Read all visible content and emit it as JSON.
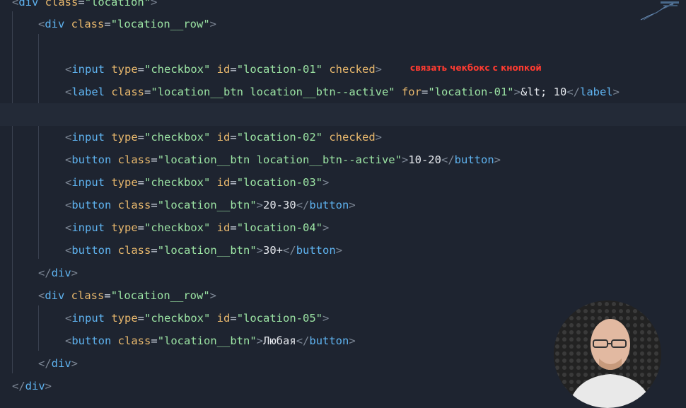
{
  "editor": {
    "lines": [
      [
        [
          "punct",
          "<"
        ],
        [
          "tag",
          "div "
        ],
        [
          "attr",
          "class"
        ],
        [
          "eq",
          "="
        ],
        [
          "str",
          "\"location\""
        ],
        [
          "punct",
          ">"
        ]
      ],
      [
        [
          "punct",
          "<"
        ],
        [
          "tag",
          "div "
        ],
        [
          "attr",
          "class"
        ],
        [
          "eq",
          "="
        ],
        [
          "str",
          "\"location__row\""
        ],
        [
          "punct",
          ">"
        ]
      ],
      [],
      [
        [
          "punct",
          "<"
        ],
        [
          "tag",
          "input "
        ],
        [
          "attr",
          "type"
        ],
        [
          "eq",
          "="
        ],
        [
          "str",
          "\"checkbox\" "
        ],
        [
          "attr",
          "id"
        ],
        [
          "eq",
          "="
        ],
        [
          "str",
          "\"location-01\" "
        ],
        [
          "attr",
          "checked"
        ],
        [
          "punct",
          ">"
        ]
      ],
      [
        [
          "punct",
          "<"
        ],
        [
          "tag",
          "label "
        ],
        [
          "attr",
          "class"
        ],
        [
          "eq",
          "="
        ],
        [
          "str",
          "\"location__btn location__btn--active\" "
        ],
        [
          "attr",
          "for"
        ],
        [
          "eq",
          "="
        ],
        [
          "str",
          "\"location-01\""
        ],
        [
          "punct",
          ">"
        ],
        [
          "text",
          "&lt; 10"
        ],
        [
          "punct",
          "</"
        ],
        [
          "tag",
          "label"
        ],
        [
          "punct",
          ">"
        ]
      ],
      [],
      [
        [
          "punct",
          "<"
        ],
        [
          "tag",
          "input "
        ],
        [
          "attr",
          "type"
        ],
        [
          "eq",
          "="
        ],
        [
          "str",
          "\"checkbox\" "
        ],
        [
          "attr",
          "id"
        ],
        [
          "eq",
          "="
        ],
        [
          "str",
          "\"location-02\" "
        ],
        [
          "attr",
          "checked"
        ],
        [
          "punct",
          ">"
        ]
      ],
      [
        [
          "punct",
          "<"
        ],
        [
          "tag",
          "button "
        ],
        [
          "attr",
          "class"
        ],
        [
          "eq",
          "="
        ],
        [
          "str",
          "\"location__btn location__btn--active\""
        ],
        [
          "punct",
          ">"
        ],
        [
          "text",
          "10-20"
        ],
        [
          "punct",
          "</"
        ],
        [
          "tag",
          "button"
        ],
        [
          "punct",
          ">"
        ]
      ],
      [
        [
          "punct",
          "<"
        ],
        [
          "tag",
          "input "
        ],
        [
          "attr",
          "type"
        ],
        [
          "eq",
          "="
        ],
        [
          "str",
          "\"checkbox\" "
        ],
        [
          "attr",
          "id"
        ],
        [
          "eq",
          "="
        ],
        [
          "str",
          "\"location-03\""
        ],
        [
          "punct",
          ">"
        ]
      ],
      [
        [
          "punct",
          "<"
        ],
        [
          "tag",
          "button "
        ],
        [
          "attr",
          "class"
        ],
        [
          "eq",
          "="
        ],
        [
          "str",
          "\"location__btn\""
        ],
        [
          "punct",
          ">"
        ],
        [
          "text",
          "20-30"
        ],
        [
          "punct",
          "</"
        ],
        [
          "tag",
          "button"
        ],
        [
          "punct",
          ">"
        ]
      ],
      [
        [
          "punct",
          "<"
        ],
        [
          "tag",
          "input "
        ],
        [
          "attr",
          "type"
        ],
        [
          "eq",
          "="
        ],
        [
          "str",
          "\"checkbox\" "
        ],
        [
          "attr",
          "id"
        ],
        [
          "eq",
          "="
        ],
        [
          "str",
          "\"location-04\""
        ],
        [
          "punct",
          ">"
        ]
      ],
      [
        [
          "punct",
          "<"
        ],
        [
          "tag",
          "button "
        ],
        [
          "attr",
          "class"
        ],
        [
          "eq",
          "="
        ],
        [
          "str",
          "\"location__btn\""
        ],
        [
          "punct",
          ">"
        ],
        [
          "text",
          "30+"
        ],
        [
          "punct",
          "</"
        ],
        [
          "tag",
          "button"
        ],
        [
          "punct",
          ">"
        ]
      ],
      [
        [
          "punct",
          "</"
        ],
        [
          "tag",
          "div"
        ],
        [
          "punct",
          ">"
        ]
      ],
      [
        [
          "punct",
          "<"
        ],
        [
          "tag",
          "div "
        ],
        [
          "attr",
          "class"
        ],
        [
          "eq",
          "="
        ],
        [
          "str",
          "\"location__row\""
        ],
        [
          "punct",
          ">"
        ]
      ],
      [
        [
          "punct",
          "<"
        ],
        [
          "tag",
          "input "
        ],
        [
          "attr",
          "type"
        ],
        [
          "eq",
          "="
        ],
        [
          "str",
          "\"checkbox\" "
        ],
        [
          "attr",
          "id"
        ],
        [
          "eq",
          "="
        ],
        [
          "str",
          "\"location-05\""
        ],
        [
          "punct",
          ">"
        ]
      ],
      [
        [
          "punct",
          "<"
        ],
        [
          "tag",
          "button "
        ],
        [
          "attr",
          "class"
        ],
        [
          "eq",
          "="
        ],
        [
          "str",
          "\"location__btn\""
        ],
        [
          "punct",
          ">"
        ],
        [
          "text",
          "Любая"
        ],
        [
          "punct",
          "</"
        ],
        [
          "tag",
          "button"
        ],
        [
          "punct",
          ">"
        ]
      ],
      [
        [
          "punct",
          "</"
        ],
        [
          "tag",
          "div"
        ],
        [
          "punct",
          ">"
        ]
      ],
      [
        [
          "punct",
          "</"
        ],
        [
          "tag",
          "div"
        ],
        [
          "punct",
          ">"
        ]
      ]
    ],
    "annotation": "связать чекбокс с кнопкой"
  },
  "colors": {
    "background": "#1e2430",
    "tag": "#5fb3f0",
    "attribute": "#e8b86d",
    "string": "#9be3a3",
    "annotation": "#ff3b30"
  }
}
